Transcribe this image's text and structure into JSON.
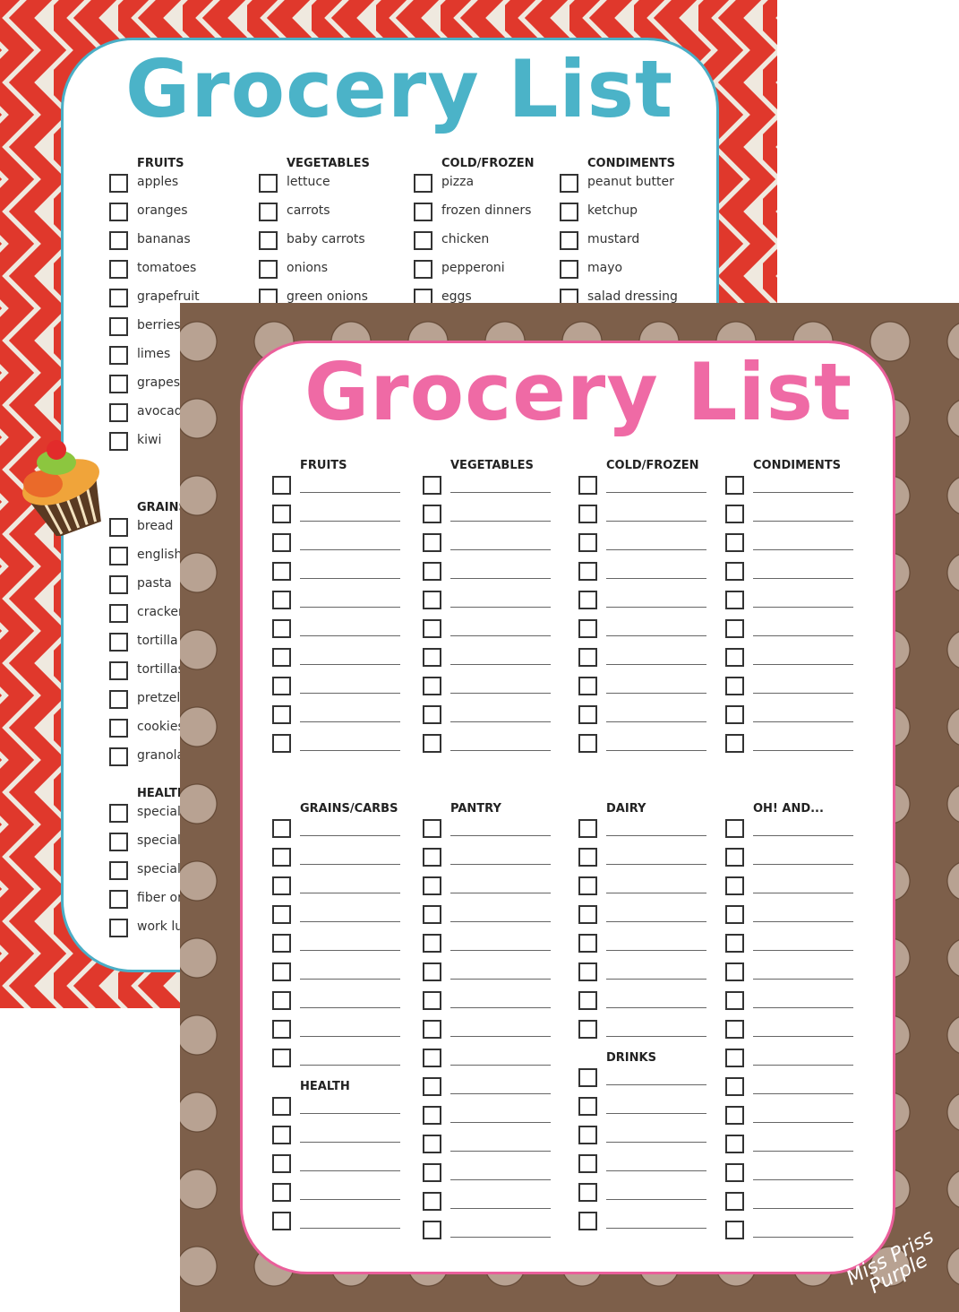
{
  "back_sheet": {
    "title": "Grocery List",
    "accent": "#4bb3c8",
    "background": "red chevron",
    "sections": [
      {
        "header": "FRUITS",
        "items": [
          "apples",
          "oranges",
          "bananas",
          "tomatoes",
          "grapefruit",
          "berries",
          "limes",
          "grapes",
          "avocad",
          "kiwi"
        ]
      },
      {
        "header": "VEGETABLES",
        "items": [
          "lettuce",
          "carrots",
          "baby carrots",
          "onions",
          "green onions"
        ]
      },
      {
        "header": "COLD/FROZEN",
        "items": [
          "pizza",
          "frozen dinners",
          "chicken",
          "pepperoni",
          "eggs"
        ]
      },
      {
        "header": "CONDIMENTS",
        "items": [
          "peanut butter",
          "ketchup",
          "mustard",
          "mayo",
          "salad dressing"
        ]
      },
      {
        "header": "GRAINS",
        "items": [
          "bread",
          "english",
          "pasta",
          "cracker",
          "tortilla",
          "tortillas",
          "pretzel",
          "cookies",
          "granola"
        ]
      },
      {
        "header": "HEALTH",
        "items": [
          "special",
          "special",
          "special",
          "fiber or",
          "work lu"
        ]
      }
    ]
  },
  "front_sheet": {
    "title": "Grocery List",
    "accent": "#ea5f9b",
    "background": "brown polka dot",
    "sections": [
      {
        "header": "FRUITS",
        "blank_lines": 10
      },
      {
        "header": "VEGETABLES",
        "blank_lines": 10
      },
      {
        "header": "COLD/FROZEN",
        "blank_lines": 10
      },
      {
        "header": "CONDIMENTS",
        "blank_lines": 10
      },
      {
        "header": "GRAINS/CARBS",
        "blank_lines": 9
      },
      {
        "header": "PANTRY",
        "blank_lines": 15
      },
      {
        "header": "DAIRY",
        "blank_lines": 8
      },
      {
        "header": "OH! AND...",
        "blank_lines": 15
      },
      {
        "header": "HEALTH",
        "blank_lines": 5
      },
      {
        "header": "DRINKS",
        "blank_lines": 6
      }
    ],
    "signature": "Miss Priss Purple"
  }
}
